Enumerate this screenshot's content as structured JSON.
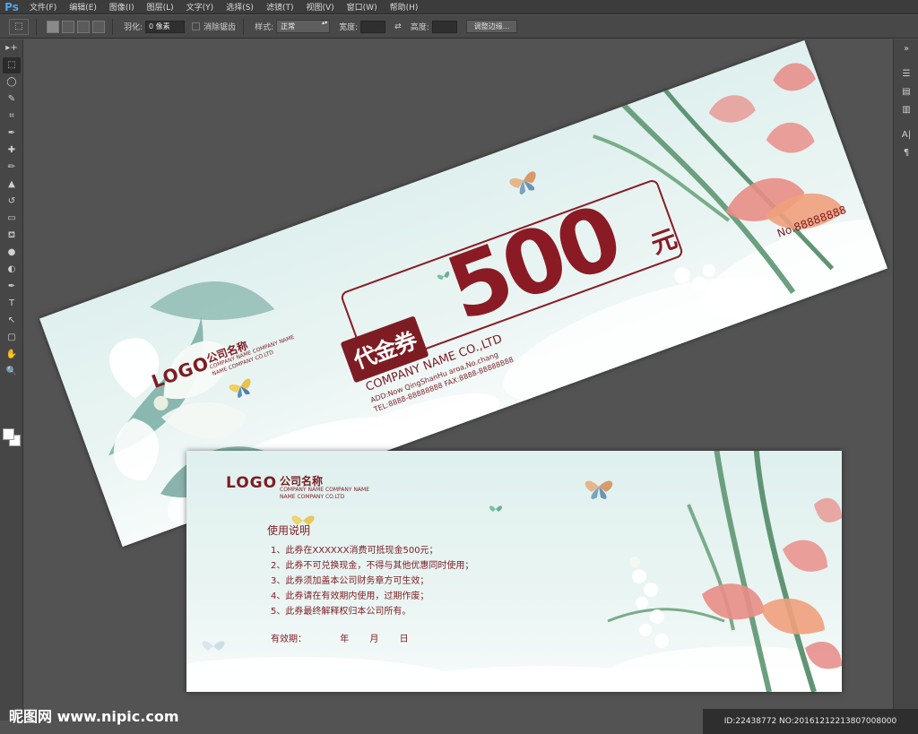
{
  "menu": {
    "app_logo": "Ps",
    "items": [
      "文件(F)",
      "编辑(E)",
      "图像(I)",
      "图层(L)",
      "文字(Y)",
      "选择(S)",
      "滤镜(T)",
      "视图(V)",
      "窗口(W)",
      "帮助(H)"
    ]
  },
  "options": {
    "feather_label": "羽化:",
    "feather_value": "0 像素",
    "antialias_label": "消除锯齿",
    "style_label": "样式:",
    "style_value": "正常",
    "width_label": "宽度:",
    "height_label": "高度:",
    "refine_label": "调整边缘..."
  },
  "toolbar": {
    "tools": [
      "move-icon",
      "marquee-icon",
      "lasso-icon",
      "quick-select-icon",
      "crop-icon",
      "eyedropper-icon",
      "healing-icon",
      "brush-icon",
      "stamp-icon",
      "history-brush-icon",
      "eraser-icon",
      "paint-bucket-icon",
      "blur-icon",
      "dodge-icon",
      "pen-icon",
      "type-icon",
      "path-select-icon",
      "shape-icon",
      "hand-icon",
      "zoom-icon"
    ],
    "tool_glyphs": [
      "▸+",
      "⬚",
      "◯",
      "✎",
      "⌗",
      "✒",
      "✚",
      "✏",
      "▲",
      "↺",
      "▭",
      "⛾",
      "●",
      "◐",
      "✒",
      "T",
      "↖",
      "▢",
      "✋",
      "🔍"
    ],
    "active_index": 1
  },
  "panels": {
    "glyphs": [
      "☰",
      "▤",
      "▥",
      "A|",
      "¶"
    ]
  },
  "front": {
    "logo": "LOGO",
    "company_cn": "公司名称",
    "company_en_1": "COMPANY NAME COMPANY NAME",
    "company_en_2": "NAME COMPANY CO.LTD",
    "tag": "代金券",
    "amount": "500",
    "yuan": "元",
    "serial": "No.88888888",
    "co_name": "COMPANY NAME CO.,LTD",
    "address": "ADD:Now QingShanHu aroa,No.chang",
    "tel": "TEL:8888-88888888  FAX:8888-88888888"
  },
  "back": {
    "logo": "LOGO",
    "company_cn": "公司名称",
    "company_en_1": "COMPANY NAME COMPANY NAME",
    "company_en_2": "NAME COMPANY CO.LTD",
    "usage_title": "使用说明",
    "usage_items": [
      "1、此券在XXXXXX消费可抵现金500元；",
      "2、此券不可兑换现金，不得与其他优惠同时使用；",
      "3、此券须加盖本公司财务章方可生效；",
      "4、此券请在有效期内使用，过期作废；",
      "5、此券最终解释权归本公司所有。"
    ],
    "validity_label": "有效期：",
    "year": "年",
    "month": "月",
    "day": "日"
  },
  "footer": {
    "watermark": "昵图网 www.nipic.com",
    "id_text": "ID:22438772 NO:20161212213807008000"
  },
  "colors": {
    "accent": "#7d1c23",
    "amount": "#8a1b24",
    "coupon_bg": "#dff0ee"
  }
}
